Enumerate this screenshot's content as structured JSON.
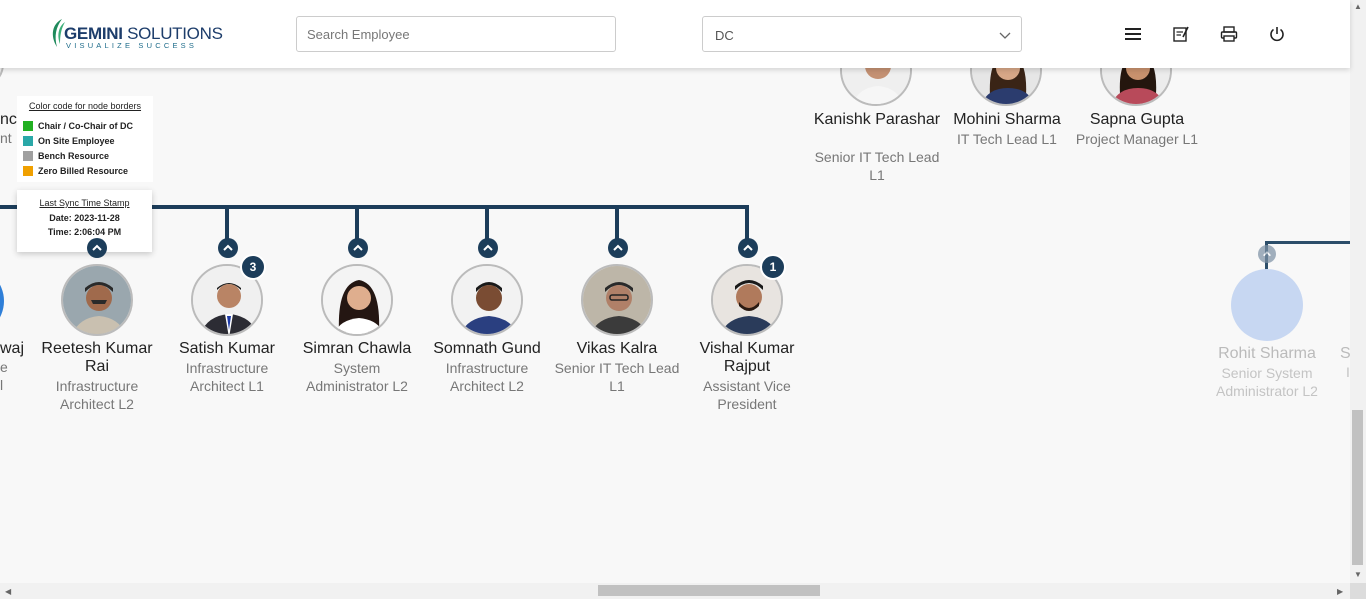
{
  "header": {
    "logo": {
      "title_bold": "GEMINI",
      "title_rest": " SOLUTIONS",
      "tagline": "VISUALIZE SUCCESS"
    },
    "search": {
      "placeholder": "Search Employee",
      "value": ""
    },
    "department": {
      "selected": "DC"
    },
    "icons": [
      "menu-icon",
      "notes-icon",
      "print-icon",
      "power-icon"
    ]
  },
  "legend": {
    "title": "Color code for node borders",
    "items": [
      {
        "label": "Chair / Co-Chair of DC",
        "color": "#22b022"
      },
      {
        "label": "On Site Employee",
        "color": "#2aa8a8"
      },
      {
        "label": "Bench Resource",
        "color": "#a0a0a0"
      },
      {
        "label": "Zero Billed Resource",
        "color": "#f0a000"
      }
    ]
  },
  "sync": {
    "title": "Last Sync Time Stamp",
    "date": "Date: 2023-11-28",
    "time": "Time: 2:06:04 PM"
  },
  "partial_left": {
    "top_name": "nc",
    "top_desig": "nt",
    "mid_name": "waj",
    "mid_desig1": "e",
    "mid_desig2": "l"
  },
  "top_nodes": [
    {
      "name": "Kanishk Parashar",
      "designation": "Senior IT Tech Lead L1"
    },
    {
      "name": "Mohini Sharma",
      "designation": "IT Tech Lead L1"
    },
    {
      "name": "Sapna Gupta",
      "designation": "Project Manager L1"
    }
  ],
  "row_nodes": [
    {
      "name": "Reetesh Kumar Rai",
      "designation": "Infrastructure Architect L2",
      "badge": ""
    },
    {
      "name": "Satish Kumar",
      "designation": "Infrastructure Architect L1",
      "badge": "3"
    },
    {
      "name": "Simran Chawla",
      "designation": "System Administrator L2",
      "badge": ""
    },
    {
      "name": "Somnath Gund",
      "designation": "Infrastructure Architect L2",
      "badge": ""
    },
    {
      "name": "Vikas Kalra",
      "designation": "Senior IT Tech Lead L1",
      "badge": ""
    },
    {
      "name": "Vishal Kumar Rajput",
      "designation": "Assistant Vice President",
      "badge": "1"
    }
  ],
  "faded_node": {
    "name": "Rohit Sharma",
    "designation": "Senior System Administrator L2",
    "edge_name": "S",
    "edge_desig": "I"
  }
}
